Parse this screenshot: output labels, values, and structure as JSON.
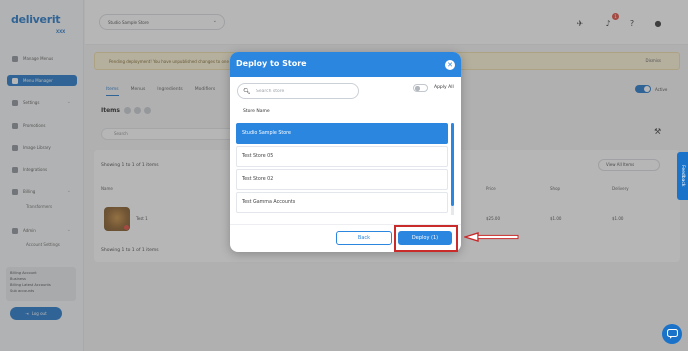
{
  "app": {
    "logo": "deliverit",
    "logo_sub": "XXX"
  },
  "sidebar": {
    "items": [
      {
        "label": "Manage Menus",
        "icon": "grid-icon"
      },
      {
        "label": "Menu Manager",
        "icon": "menu-icon"
      },
      {
        "label": "Settings",
        "icon": "gear-icon"
      },
      {
        "label": "Promotions",
        "icon": "tag-icon"
      },
      {
        "label": "Image Library",
        "icon": "image-icon"
      },
      {
        "label": "Integrations",
        "icon": "plug-icon"
      },
      {
        "label": "Billing",
        "icon": "card-icon"
      },
      {
        "label": "Admin",
        "icon": "lock-icon"
      }
    ],
    "sub_items": [
      "Transformers",
      "Account Settings"
    ],
    "account_lines": [
      "Billing Account",
      "Business",
      "Billing Latest Accounts",
      "Sub accounts"
    ],
    "logout_label": "Log out"
  },
  "topbar": {
    "store_select_value": "Studio Sample Store",
    "notification_count": "1"
  },
  "background": {
    "banner_text": "Pending deployment! You have unpublished changes to one or more stores.",
    "banner_dismiss": "Dismiss",
    "tabs": [
      "Items",
      "Menus",
      "Ingredients",
      "Modifiers"
    ],
    "toggle_label": "Active",
    "items_heading": "Items",
    "search_placeholder": "Search",
    "showing_text": "Showing 1 to 1 of 1 items",
    "view_select_value": "View All Items",
    "columns": [
      "Name",
      "Price",
      "Shop",
      "Delivery"
    ],
    "row": {
      "name": "Test 1",
      "price": "$25.00",
      "shop": "$1.00",
      "delivery": "$1.00"
    },
    "showing_text_bottom": "Showing 1 to 1 of 1 items"
  },
  "modal": {
    "title": "Deploy to Store",
    "search_placeholder": "Search store",
    "apply_all_label": "Apply All",
    "list_header": "Store Name",
    "stores": [
      {
        "name": "Studio Sample Store",
        "selected": true
      },
      {
        "name": "Test Store 05",
        "selected": false
      },
      {
        "name": "Test Store 02",
        "selected": false
      },
      {
        "name": "Test Gamma Accounts",
        "selected": false
      }
    ],
    "back_label": "Back",
    "deploy_label": "Deploy (1)"
  },
  "feedback_label": "Feedback",
  "colors": {
    "primary": "#2b86e0",
    "annotation": "#c92a2a"
  }
}
